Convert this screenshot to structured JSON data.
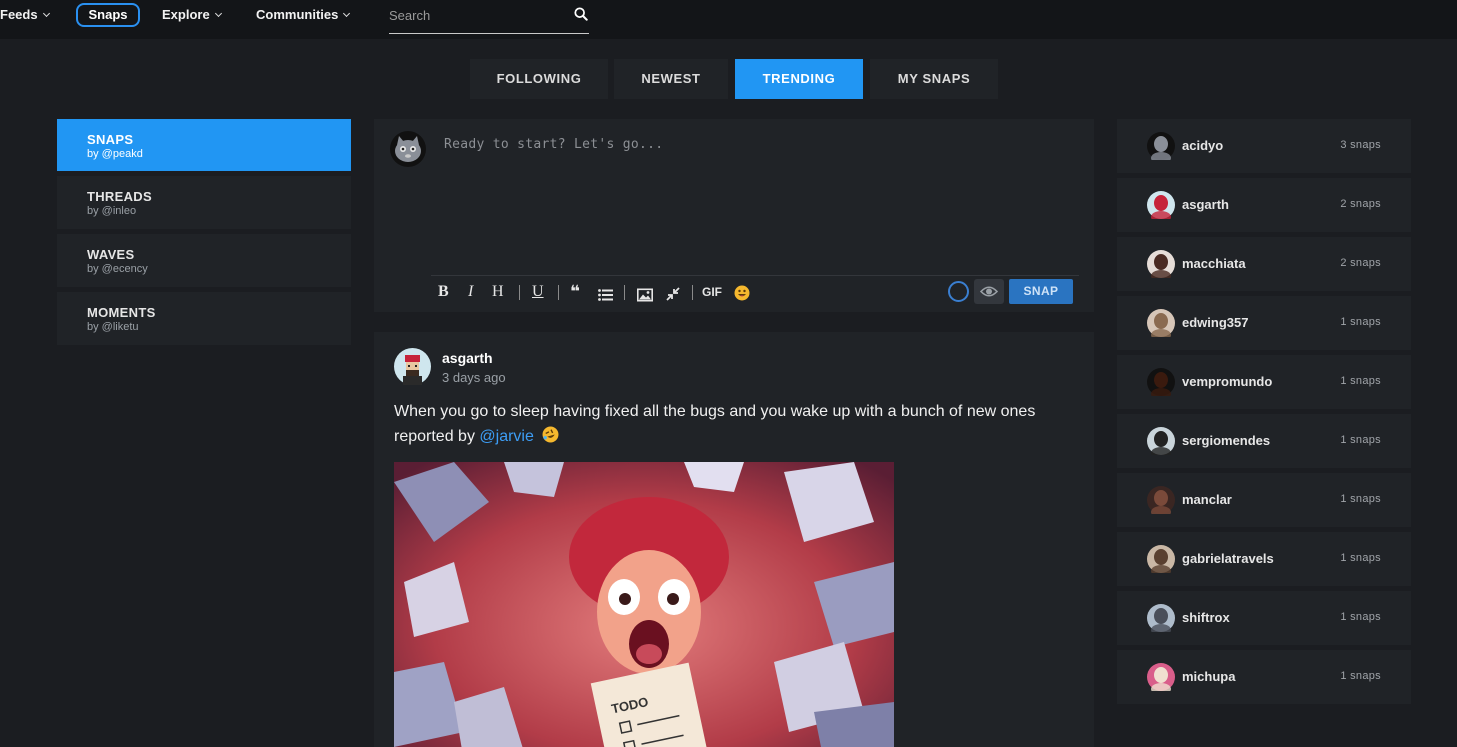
{
  "nav": {
    "feeds": "Feeds",
    "snaps": "Snaps",
    "explore": "Explore",
    "communities": "Communities",
    "search_placeholder": "Search"
  },
  "tabs": [
    "FOLLOWING",
    "NEWEST",
    "TRENDING",
    "MY SNAPS"
  ],
  "active_tab": "TRENDING",
  "left_menu": [
    {
      "title": "SNAPS",
      "sub": "by @peakd"
    },
    {
      "title": "THREADS",
      "sub": "by @inleo"
    },
    {
      "title": "WAVES",
      "sub": "by @ecency"
    },
    {
      "title": "MOMENTS",
      "sub": "by @liketu"
    }
  ],
  "composer": {
    "placeholder": "Ready to start? Let's go...",
    "gif_label": "GIF",
    "snap_button": "SNAP"
  },
  "post": {
    "author": "asgarth",
    "time": "3 days ago",
    "text": "When you go to sleep having fixed all the bugs and you wake up with a bunch of new ones reported by ",
    "mention": "@jarvie",
    "image_note": "TODO"
  },
  "users": [
    {
      "name": "acidyo",
      "count": "3 snaps"
    },
    {
      "name": "asgarth",
      "count": "2 snaps"
    },
    {
      "name": "macchiata",
      "count": "2 snaps"
    },
    {
      "name": "edwing357",
      "count": "1 snaps"
    },
    {
      "name": "vempromundo",
      "count": "1 snaps"
    },
    {
      "name": "sergiomendes",
      "count": "1 snaps"
    },
    {
      "name": "manclar",
      "count": "1 snaps"
    },
    {
      "name": "gabrielatravels",
      "count": "1 snaps"
    },
    {
      "name": "shiftrox",
      "count": "1 snaps"
    },
    {
      "name": "michupa",
      "count": "1 snaps"
    }
  ],
  "colors": {
    "accent": "#2196f3",
    "background": "#1b1d21",
    "panel": "#202327",
    "topbar": "#131518"
  }
}
